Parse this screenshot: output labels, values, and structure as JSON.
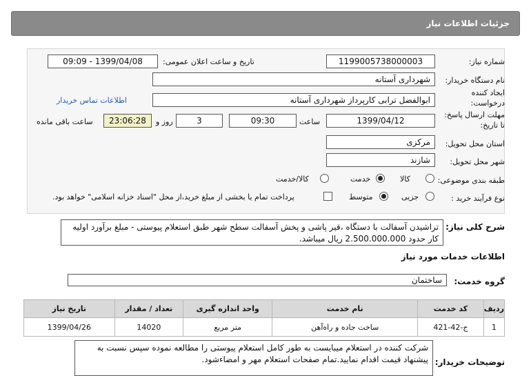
{
  "header": {
    "title": "جزئیات اطلاعات نیاز"
  },
  "form": {
    "need_number": {
      "label": "شماره نیاز:",
      "value": "1199005738000003"
    },
    "announce_date": {
      "label": "تاریخ و ساعت اعلان عمومی:",
      "value": "1399/04/08 - 09:09"
    },
    "buyer_org": {
      "label": "نام دستگاه خریدار:",
      "value": "شهرداری آستانه"
    },
    "creator": {
      "label_line1": "ایجاد کننده",
      "label_line2": "درخواست:",
      "value": "ابوالفضل  ترابی  کارپرداز  شهرداری آستانه"
    },
    "contact_link": "اطلاعات تماس خریدار",
    "deadline": {
      "label_line1": "مهلت ارسال پاسخ:",
      "label_line2": "تا تاریخ:",
      "date": "1399/04/12",
      "time_label": "ساعت",
      "time": "09:30",
      "days_label": "روز و",
      "days": "3",
      "remaining": "23:06:28",
      "remaining_label": "ساعت باقی مانده"
    },
    "province": {
      "label": "استان محل تحویل:",
      "value": "مرکزی"
    },
    "city": {
      "label": "شهر محل تحویل:",
      "value": "شازند"
    },
    "category": {
      "label": "طبقه بندی موضوعی:",
      "options": [
        "کالا",
        "خدمت",
        "کالا/خدمت"
      ],
      "selected": "خدمت"
    },
    "purchase_type": {
      "label": "نوع فرآیند خرید :",
      "options": [
        "جزیی",
        "متوسط"
      ],
      "selected": "متوسط",
      "checkbox_text": "پرداخت تمام یا بخشی از مبلغ خرید،از محل \"اسناد خزانه اسلامی\" خواهد بود."
    }
  },
  "description": {
    "label": "شرح کلی نیاز:",
    "line1": "تراشیدن آسفالت با دستگاه ،قیر پاشی و پخش آسفالت سطح شهر طبق استعلام پیوستی - مبلغ برآورد اولیه",
    "line2": "کار حدود 2.500.000.000 ریال میباشد."
  },
  "services": {
    "section_title": "اطلاعات خدمات مورد نیاز",
    "group_label": "گروه خدمت:",
    "group_value": "ساختمان",
    "columns": [
      "ردیف",
      "کد خدمت",
      "نام خدمت",
      "واحد اندازه گیری",
      "تعداد / مقدار",
      "تاریخ نیاز"
    ],
    "rows": [
      {
        "row": "1",
        "code": "ج-42-421",
        "name": "ساخت جاده و راه‌آهن",
        "unit": "متر مربع",
        "qty": "14020",
        "date": "1399/04/26"
      }
    ]
  },
  "notes": {
    "label": "توضیحات خریدار:",
    "line1": "شرکت کننده در استعلام میبایست به طور کامل استعلام پیوستی را مطالعه نموده سپس نسبت به",
    "line2": "پیشنهاد قیمت اقدام نمایید.تمام صفحات استعلام مهر و امضاءشود."
  }
}
